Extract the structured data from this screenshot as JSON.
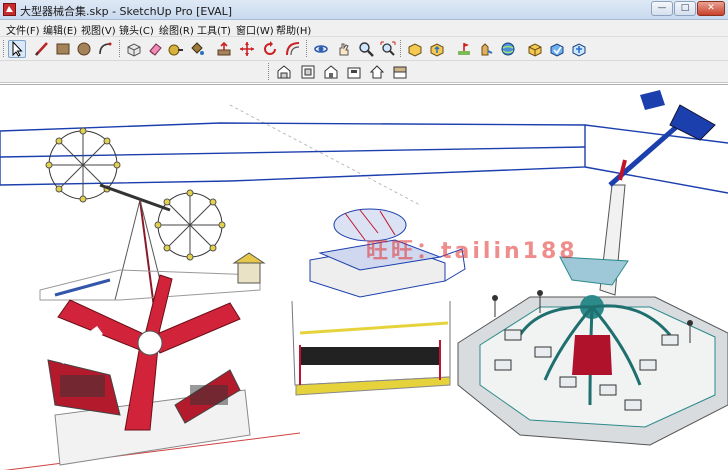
{
  "window": {
    "title": "大型器械合集.skp - SketchUp Pro [EVAL]",
    "controls": {
      "minimize": "—",
      "maximize": "□",
      "close": "✕"
    }
  },
  "menu": {
    "items": [
      "文件(F)",
      "编辑(E)",
      "视图(V)",
      "镜头(C)",
      "绘图(R)",
      "工具(T)",
      "窗口(W)",
      "帮助(H)"
    ]
  },
  "toolbar": {
    "tools": [
      "select-icon",
      "line-icon",
      "rectangle-icon",
      "circle-icon",
      "arc-icon",
      "make-component-icon",
      "eraser-icon",
      "tape-measure-icon",
      "paint-bucket-icon",
      "push-pull-icon",
      "move-icon",
      "rotate-icon",
      "offset-icon",
      "orbit-icon",
      "pan-icon",
      "zoom-icon",
      "zoom-extents-icon",
      "get-models-icon",
      "share-model-icon",
      "add-location-icon",
      "preview-google-earth-icon",
      "warehouse-icon",
      "extension-icon",
      "component-icon"
    ]
  },
  "views_toolbar": {
    "tools": [
      "iso-view-icon",
      "top-view-icon",
      "front-view-icon",
      "right-view-icon",
      "back-view-icon",
      "left-view-icon"
    ]
  },
  "viewport": {
    "watermark": "旺旺：tailin188"
  },
  "colors": {
    "watermark": "#e12d2d",
    "fence": "#1c3fae",
    "ride_red": "#c0142c",
    "ride_teal": "#2d8a8a"
  }
}
